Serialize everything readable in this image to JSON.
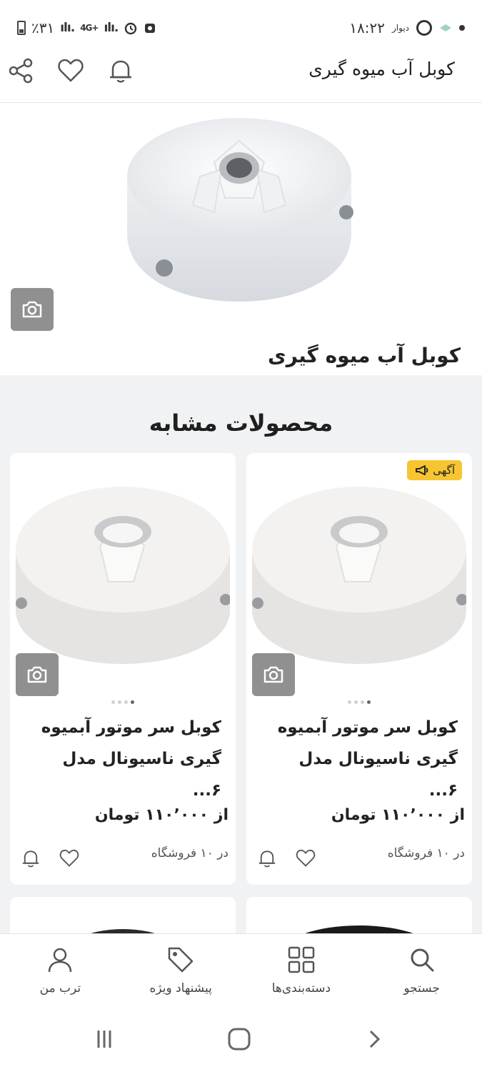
{
  "status_bar": {
    "time": "۱۸:۲۲",
    "carrier": "دیوار",
    "battery": "٪۳۱",
    "network": "4G+"
  },
  "header": {
    "title": "کوبل آب میوه گیری"
  },
  "product": {
    "name": "کوبل آب میوه گیری"
  },
  "similar": {
    "title": "محصولات مشابه",
    "cards": [
      {
        "badge": "آگهی",
        "title": "کوبل سر موتور آبمیوه گیری ناسیونال مدل ۶...",
        "price": "از ۱۱۰٬۰۰۰ تومان",
        "shops": "در ۱۰ فروشگاه"
      },
      {
        "badge": "",
        "title": "کوبل سر موتور آبمیوه گیری ناسیونال مدل ۶...",
        "price": "از ۱۱۰٬۰۰۰ تومان",
        "shops": "در ۱۰ فروشگاه"
      }
    ]
  },
  "bottom_nav": {
    "search": "جستجو",
    "categories": "دسته‌بندی‌ها",
    "offers": "پیشنهاد ویژه",
    "my_torob": "ترب من"
  },
  "colors": {
    "badge": "#f6c531",
    "camera_button": "#909090",
    "section_bg": "#f1f2f4"
  }
}
